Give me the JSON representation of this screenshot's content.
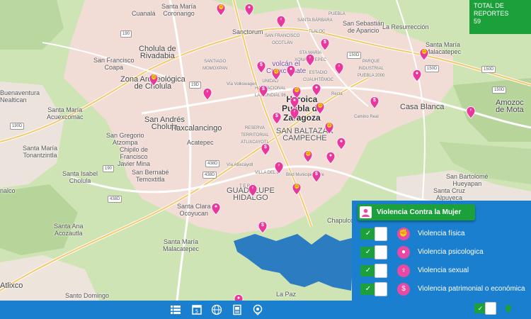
{
  "map": {
    "labels": {
      "cuanala": "Cuanalá",
      "santa_maria_coronango": "Santa María\nCoronango",
      "sanctorum": "Sanctorum",
      "san_sebastian_aparicio": "San Sebastián\nde Aparicio",
      "la_resurreccion": "La Resurrección",
      "cholula_rivadabia": "Cholula de\nRivadabia",
      "san_francisco_coapa": "San Francisco\nCoapa",
      "zona_arqueologica": "Zona Arqueológica\nde Cholula",
      "santa_maria_malacatepec_ne": "Santa María\nMalacatepec",
      "buenaventura": "Buenaventura\nNealtican",
      "santa_maria_acuexcomac": "Santa María\nAcuexcomac",
      "san_andres_cholula": "San Andrés\nCholula",
      "tlaxcalancingo": "Tlaxcalancingo",
      "heroica_puebla": "Heroica\nPuebla de\nZaragoza",
      "san_baltazar_campeche": "SAN BALTAZAR\nCAMPECHE",
      "casa_blanca": "Casa Blanca",
      "amozoc": "Amozoc\nde Mota",
      "san_gregorio": "San Gregorio\nAtzompa",
      "chipilo": "Chipilo de\nFrancisco\nJavier Mina",
      "acatepec": "Acatepec",
      "santa_maria_tonantzintla": "Santa María\nTonantzintla",
      "san_bernabe": "San Bernabé\nTemoxtitla",
      "santa_isabel_cholula": "Santa Isabel\nCholula",
      "guadalupe_hidalgo": "GUADALUPE\nHIDALGO",
      "san_bartolome": "San Bartolomé\nHueyapan",
      "santa_cruz_alpuyeca": "Santa Cruz\nAlpuyeca",
      "santa_clara_ocoyucan": "Santa Clara\nOcoyucan",
      "santa_ana_acozautla": "Santa Ana\nAcozautla",
      "santa_maria_malacatepec_sw": "Santa María\nMalacatepec",
      "atlixco": "Atlixco",
      "santo_domingo": "Santo Domingo",
      "la_paz": "La Paz",
      "chapulco": "Chapulco",
      "nalco": "nalco",
      "volcan_cuexcomate": "volcán el\nCuexcomate",
      "villa_del_e": "VILLA DEL E",
      "t_e_r_m": "T E R M",
      "estadio_cuauhtemoc": "ESTADIO\nCUAUHTÉMOC",
      "parque_industrial": "PARQUE\nINDUSTRIAL\nPUEBLA 2000",
      "sta_maria_xonacatepec": "STA MARÍA\nXONACATEPEC",
      "unidad_habitacional": "UNIDAD\nHABITACIONAL\nLA MUNDIAL 96",
      "reserva_territorial": "RESERVA\nTERRITORIAL\nATLIXCAYOTL",
      "santiago_momoxpan": "SANTIAGO\nMOMOXPAN",
      "san_francisco_ocotlan": "SAN FRANCISCO\nOCOTLÁN",
      "tlaloc": "TLALOC",
      "santa_barbara": "SANTA BÁRBARA",
      "puebla_small": "PUEBLA",
      "vía_volkswagen": "Vía Volkswagen",
      "recta": "Recta",
      "blvd_municipio": "Blvd Municipio Libre",
      "camino_real": "Camino Real",
      "via_atlixcayotl": "Vía Atlixcáyotl"
    },
    "routes": [
      "190",
      "190",
      "190D",
      "150D",
      "150D",
      "150D",
      "150D",
      "438D",
      "438D",
      "438D",
      "19D"
    ]
  },
  "total": {
    "title": "TOTAL DE\nREPORTES",
    "count": "59"
  },
  "panel": {
    "title": "Violencia Contra la Mujer",
    "items": [
      {
        "label": "Violencia física",
        "icon": "fist-icon"
      },
      {
        "label": "Violencia psicologica",
        "icon": "head-icon"
      },
      {
        "label": "Violencia sexual",
        "icon": "people-icon"
      },
      {
        "label": "Violencia patrimonial o económica",
        "icon": "money-icon"
      }
    ],
    "check": "✓"
  },
  "bottombar": {
    "icons": [
      "list-icon",
      "calendar-icon",
      "globe-icon",
      "document-icon",
      "location-icon"
    ],
    "check": "✓"
  },
  "colors": {
    "accent_green": "#1ca03b",
    "panel_blue": "#1b7fd0",
    "pin_pink": "#e8389e"
  }
}
